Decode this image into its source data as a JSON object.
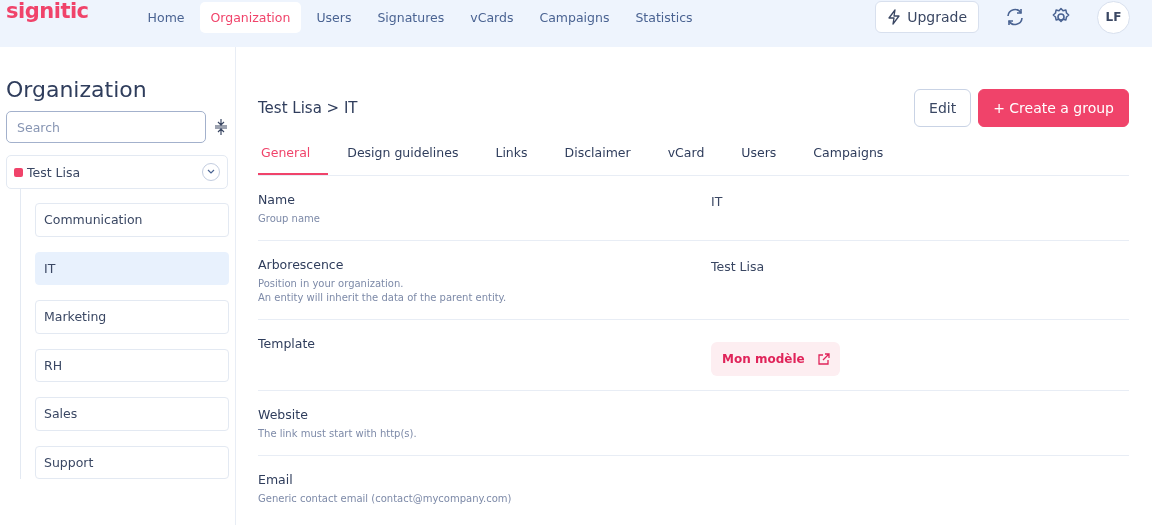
{
  "header": {
    "logo": "signitic",
    "nav": [
      {
        "label": "Home",
        "selected": false
      },
      {
        "label": "Organization",
        "selected": true
      },
      {
        "label": "Users",
        "selected": false
      },
      {
        "label": "Signatures",
        "selected": false
      },
      {
        "label": "vCards",
        "selected": false
      },
      {
        "label": "Campaigns",
        "selected": false
      },
      {
        "label": "Statistics",
        "selected": false
      }
    ],
    "upgrade": "Upgrade",
    "avatar": "LF"
  },
  "sidebar": {
    "title": "Organization",
    "search": {
      "placeholder": "Search"
    },
    "tree": [
      {
        "label": "Test Lisa",
        "color": "#f0436a",
        "expanded": true,
        "selected": false,
        "children": [
          {
            "label": "Communication",
            "selected": false
          },
          {
            "label": "IT",
            "selected": true
          },
          {
            "label": "Marketing",
            "selected": false
          },
          {
            "label": "RH",
            "selected": false
          },
          {
            "label": "Sales",
            "selected": false
          },
          {
            "label": "Support",
            "selected": false
          }
        ]
      }
    ]
  },
  "main": {
    "breadcrumb": "Test Lisa > IT",
    "buttons": [
      {
        "label": "Edit",
        "kind": "secondary"
      },
      {
        "label": "+ Create a group",
        "kind": "primary"
      }
    ],
    "tabs": [
      {
        "label": "General",
        "selected": true
      },
      {
        "label": "Design guidelines",
        "selected": false
      },
      {
        "label": "Links",
        "selected": false
      },
      {
        "label": "Disclaimer",
        "selected": false
      },
      {
        "label": "vCard",
        "selected": false
      },
      {
        "label": "Users",
        "selected": false
      },
      {
        "label": "Campaigns",
        "selected": false
      }
    ],
    "fields": [
      {
        "label": "Name",
        "hint": [
          "Group name"
        ],
        "kind": "text",
        "value": "IT"
      },
      {
        "label": "Arborescence",
        "hint": [
          "Position in your organization.",
          "An entity will inherit the data of the parent entity."
        ],
        "kind": "text",
        "value": "Test Lisa"
      },
      {
        "label": "Template",
        "kind": "link",
        "value": "Mon modèle"
      },
      {
        "label": "Website",
        "hint": [
          "The link must start with http(s)."
        ]
      },
      {
        "label": "Email",
        "hint": [
          "Generic contact email (contact@mycompany.com)"
        ]
      }
    ]
  }
}
